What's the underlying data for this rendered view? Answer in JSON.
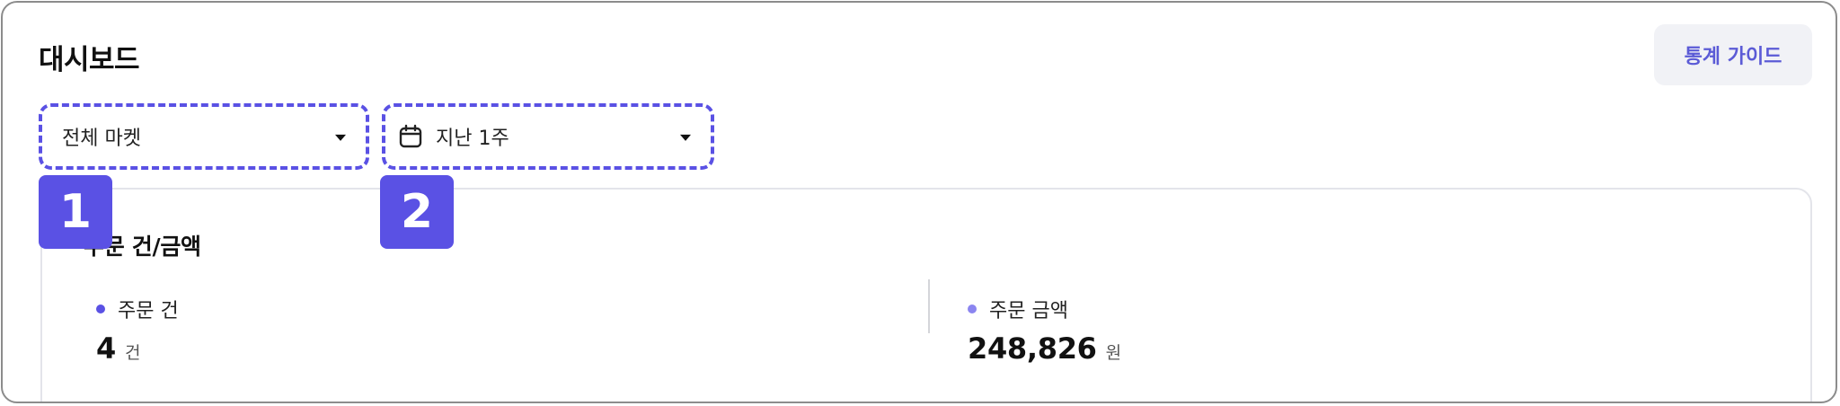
{
  "header": {
    "title": "대시보드",
    "guide_button_label": "통계 가이드"
  },
  "filters": {
    "market": {
      "selected": "전체 마켓"
    },
    "period": {
      "selected": "지난 1주"
    }
  },
  "step_badges": [
    "1",
    "2"
  ],
  "summary_card": {
    "title": "주문 건/금액",
    "metrics": [
      {
        "label": "주문 건",
        "value": "4",
        "unit": "건"
      },
      {
        "label": "주문 금액",
        "value": "248,826",
        "unit": "원"
      }
    ]
  },
  "colors": {
    "accent": "#5a51e4",
    "accent_light": "#8b85f0",
    "guide_text": "#5b5bd6",
    "guide_bg": "#f1f2f6"
  },
  "icons": {
    "period_icon": "calendar-icon",
    "dropdown_icon": "caret-down-icon"
  }
}
